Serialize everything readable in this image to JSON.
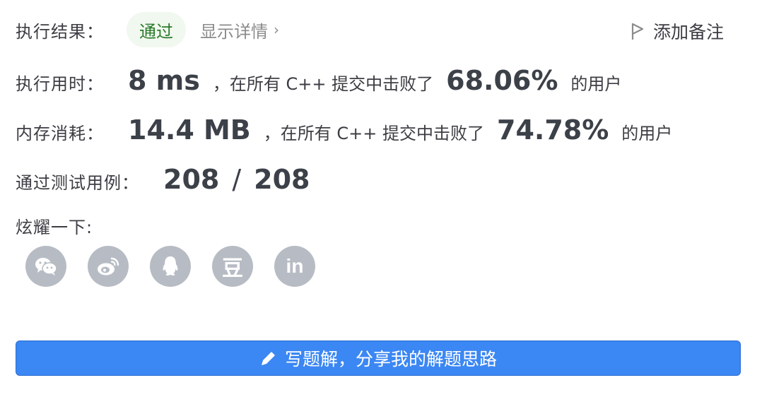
{
  "result": {
    "label": "执行结果：",
    "status": "通过",
    "details_link": "显示详情",
    "details_chevron": "›",
    "add_note": "添加备注"
  },
  "runtime": {
    "label": "执行用时：",
    "value": "8 ms",
    "middle": "，在所有 C++ 提交中击败了",
    "percent": "68.06%",
    "suffix": "的用户"
  },
  "memory": {
    "label": "内存消耗：",
    "value": "14.4 MB",
    "middle": "，在所有 C++ 提交中击败了",
    "percent": "74.78%",
    "suffix": "的用户"
  },
  "tests": {
    "label": "通过测试用例：",
    "passed": "208",
    "separator": "/",
    "total": "208"
  },
  "share": {
    "label": "炫耀一下:",
    "icons": [
      "wechat-icon",
      "weibo-icon",
      "qq-icon",
      "douban-icon",
      "linkedin-icon"
    ],
    "douban_glyph": "豆",
    "linkedin_glyph": "in"
  },
  "write_button": {
    "label": "写题解，分享我的解题思路"
  },
  "colors": {
    "accent": "#3b87f3",
    "pass_bg": "#f1f8ef",
    "pass_text": "#2a7a2a",
    "social_bg": "#b7bcc4"
  }
}
